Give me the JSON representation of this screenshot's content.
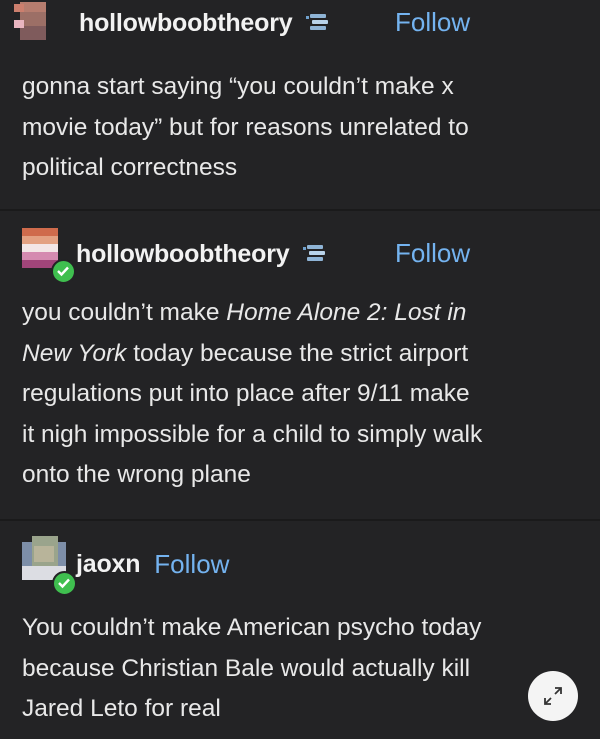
{
  "posts": [
    {
      "username": "hollowboobtheory",
      "follow_label": "Follow",
      "lines": [
        "gonna start saying “you couldn’t make x",
        "movie today” but for reasons unrelated to",
        "political correctness"
      ]
    },
    {
      "username": "hollowboobtheory",
      "follow_label": "Follow",
      "italic_1": "Home Alone 2: Lost in",
      "italic_2": "New York",
      "lines": [
        "you couldn’t make ",
        " today because the strict airport",
        "regulations put into place after 9/11 make",
        "it nigh impossible for a child to simply walk",
        "onto the wrong plane"
      ]
    },
    {
      "username": "jaoxn",
      "follow_label": "Follow",
      "lines": [
        "You couldn’t make American psycho today",
        "because Christian Bale would actually kill",
        "Jared Leto for real"
      ]
    }
  ],
  "icons": {
    "stack": "stack-icon",
    "expand": "expand-icon",
    "follow_badge": "check-badge-icon"
  },
  "colors": {
    "background": "#232325",
    "link": "#74b3f0",
    "badge": "#3fbf4f"
  }
}
